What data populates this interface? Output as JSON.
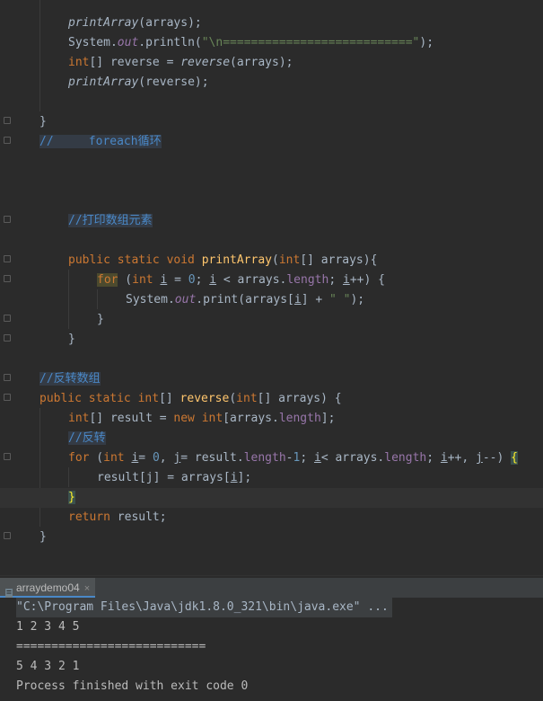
{
  "editor": {
    "lines": {
      "l1_fn": "printArray",
      "l1_rest": "(arrays);",
      "l2_a": "System.",
      "l2_out": "out",
      "l2_b": ".println(",
      "l2_esc": "\"\\n",
      "l2_str": "===========================\"",
      "l2_c": ");",
      "l3_kw": "int",
      "l3_a": "[] reverse = ",
      "l3_fn": "reverse",
      "l3_b": "(arrays);",
      "l4_fn": "printArray",
      "l4_rest": "(reverse);",
      "l6_brace": "}",
      "l7_cmt": "//     foreach循环",
      "l11_cmt": "//打印数组元素",
      "l13_kw1": "public static void ",
      "l13_fn": "printArray",
      "l13_a": "(",
      "l13_kw2": "int",
      "l13_b": "[] arrays){",
      "l14_for": "for",
      "l14_a": " (",
      "l14_kw": "int ",
      "l14_i1": "i",
      "l14_b": " = ",
      "l14_num": "0",
      "l14_c": "; ",
      "l14_i2": "i",
      "l14_d": " < arrays.",
      "l14_len": "length",
      "l14_e": "; ",
      "l14_i3": "i",
      "l14_f": "++) {",
      "l15_a": "System.",
      "l15_out": "out",
      "l15_b": ".print(arrays[",
      "l15_i": "i",
      "l15_c": "] + ",
      "l15_str": "\" \"",
      "l15_d": ");",
      "l16_brace": "}",
      "l17_brace": "}",
      "l19_cmt": "//反转数组",
      "l20_kw1": "public static ",
      "l20_kw2": "int",
      "l20_a": "[] ",
      "l20_fn": "reverse",
      "l20_b": "(",
      "l20_kw3": "int",
      "l20_c": "[] arrays) {",
      "l21_kw": "int",
      "l21_a": "[] result = ",
      "l21_new": "new ",
      "l21_kw2": "int",
      "l21_b": "[arrays.",
      "l21_len": "length",
      "l21_c": "];",
      "l22_cmt": "//反转",
      "l23_for": "for",
      "l23_a": " (",
      "l23_kw": "int ",
      "l23_i1": "i",
      "l23_b": "= ",
      "l23_n0": "0",
      "l23_c": ", ",
      "l23_j1": "j",
      "l23_d": "= result.",
      "l23_len1": "length",
      "l23_e": "-",
      "l23_n1": "1",
      "l23_f": "; ",
      "l23_i2": "i",
      "l23_g": "< arrays.",
      "l23_len2": "length",
      "l23_h": "; ",
      "l23_i3": "i",
      "l23_k": "++, ",
      "l23_j2": "j",
      "l23_m": "--) ",
      "l23_brace": "{",
      "l24_a": "result[j] = arrays[",
      "l24_i": "i",
      "l24_b": "];",
      "l25_brace": "}",
      "l26_kw": "return",
      "l26_a": " result;",
      "l27_brace": "}"
    }
  },
  "run_panel": {
    "tab_label": "arraydemo04",
    "tab_close": "×",
    "output": [
      "\"C:\\Program Files\\Java\\jdk1.8.0_321\\bin\\java.exe\" ...",
      "1 2 3 4 5",
      "===========================",
      "5 4 3 2 1",
      "Process finished with exit code 0"
    ]
  },
  "colors": {
    "background": "#2b2b2b",
    "keyword": "#cc7832",
    "function": "#ffc66d",
    "field": "#9876aa",
    "string": "#6a8759",
    "number": "#6897bb",
    "comment": "#629755"
  }
}
